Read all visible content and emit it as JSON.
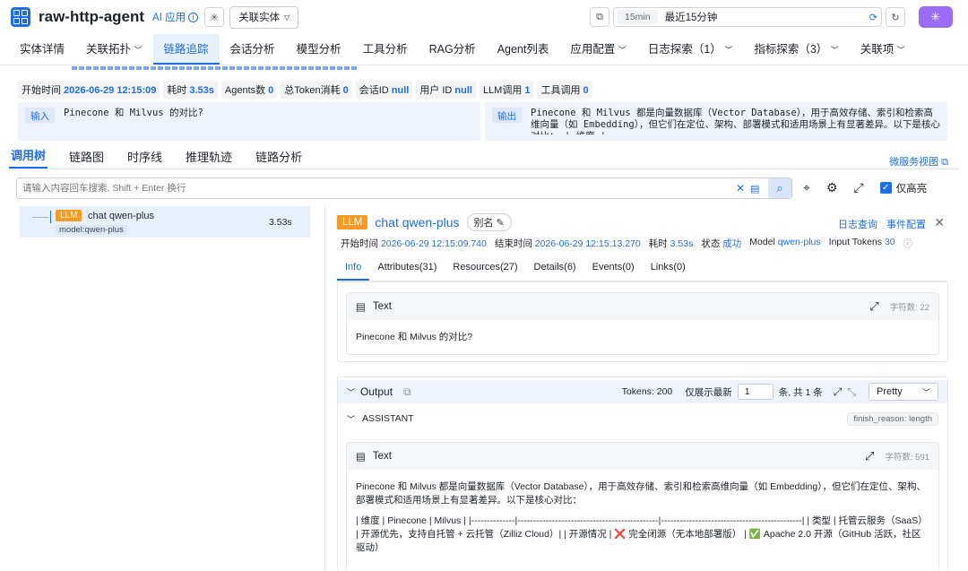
{
  "header": {
    "app_title": "raw-http-agent",
    "ai_badge": "AI 应用",
    "entity_button": "关联实体",
    "time_chip": "15min",
    "time_range": "最近15分钟"
  },
  "nav": {
    "items": [
      {
        "label": "实体详情"
      },
      {
        "label": "关联拓扑"
      },
      {
        "label": "链路追踪"
      },
      {
        "label": "会话分析"
      },
      {
        "label": "模型分析"
      },
      {
        "label": "工具分析"
      },
      {
        "label": "RAG分析"
      },
      {
        "label": "Agent列表"
      },
      {
        "label": "应用配置"
      },
      {
        "label": "日志探索（1）"
      },
      {
        "label": "指标探索（3）"
      },
      {
        "label": "关联项"
      }
    ]
  },
  "trace": {
    "meta": [
      {
        "label": "开始时间",
        "value": "2026-06-29 12:15:09"
      },
      {
        "label": "耗时",
        "value": "3.53s"
      },
      {
        "label": "Agents数",
        "value": "0"
      },
      {
        "label": "总Token消耗",
        "value": "0"
      },
      {
        "label": "会话ID",
        "value": "null"
      },
      {
        "label": "用户 ID",
        "value": "null"
      },
      {
        "label": "LLM调用",
        "value": "1"
      },
      {
        "label": "工具调用",
        "value": "0"
      }
    ],
    "input_label": "输入",
    "input_text": "Pinecone 和 Milvus 的对比?",
    "output_label": "输出",
    "output_text": "Pinecone 和 Milvus 都是向量数据库（Vector Database），用于高效存储、索引和检索高维向量（如 Embedding），但它们在定位、架构、部署模式和适用场景上有显著差异。以下是核心对比： | 维度 |..."
  },
  "tabs": {
    "items": [
      {
        "label": "调用树"
      },
      {
        "label": "链路图"
      },
      {
        "label": "时序线"
      },
      {
        "label": "推理轨迹"
      },
      {
        "label": "链路分析"
      }
    ],
    "micro_link": "微服务视图"
  },
  "search": {
    "placeholder": "请输入内容回车搜索, Shift + Enter 换行",
    "only_highlight": "仅高亮"
  },
  "tree": {
    "tag": "LLM",
    "name": "chat qwen-plus",
    "model": "model:qwen-plus",
    "duration": "3.53s"
  },
  "detail": {
    "tag": "LLM",
    "name": "chat qwen-plus",
    "alias": "别名",
    "log_link": "日志查询",
    "event_link": "事件配置",
    "meta": [
      {
        "label": "开始时间",
        "value": "2026-06-29 12:15:09.740"
      },
      {
        "label": "结束时间",
        "value": "2026-06-29 12:15:13.270"
      },
      {
        "label": "耗时",
        "value": "3.53s"
      },
      {
        "label": "状态",
        "value": "成功"
      },
      {
        "label": "Model",
        "value": "qwen-plus"
      },
      {
        "label": "Input Tokens",
        "value": "30"
      }
    ],
    "tabs": [
      {
        "label": "Info"
      },
      {
        "label": "Attributes(31)"
      },
      {
        "label": "Resources(27)"
      },
      {
        "label": "Details(6)"
      },
      {
        "label": "Events(0)"
      },
      {
        "label": "Links(0)"
      }
    ],
    "input_card": {
      "title": "Text",
      "count": "字符数: 22",
      "body": "Pinecone 和 Milvus 的对比?"
    },
    "output": {
      "title": "Output",
      "tokens": "Tokens: 200",
      "show_latest": "仅展示最新",
      "latest_value": "1",
      "total_text": "条, 共 1 条",
      "format": "Pretty",
      "role": "ASSISTANT",
      "finish_reason": "finish_reason: length",
      "card_title": "Text",
      "card_count": "字符数: 591",
      "para1": "Pinecone 和 Milvus 都是向量数据库（Vector Database），用于高效存储、索引和检索高维向量（如 Embedding），但它们在定位、架构、部署模式和适用场景上有显著差异。以下是核心对比：",
      "para2": "| 维度 | Pinecone | Milvus | |--------------|---------------------------------------------|---------------------------------------------| | 类型 | 托管云服务（SaaS） | 开源优先，支持自托管 + 云托管（Zilliz Cloud）| | 开源情况 | ❌ 完全闭源（无本地部署版） | ✅ Apache 2.0 开源（GitHub 活跃，社区驱动）"
    }
  }
}
